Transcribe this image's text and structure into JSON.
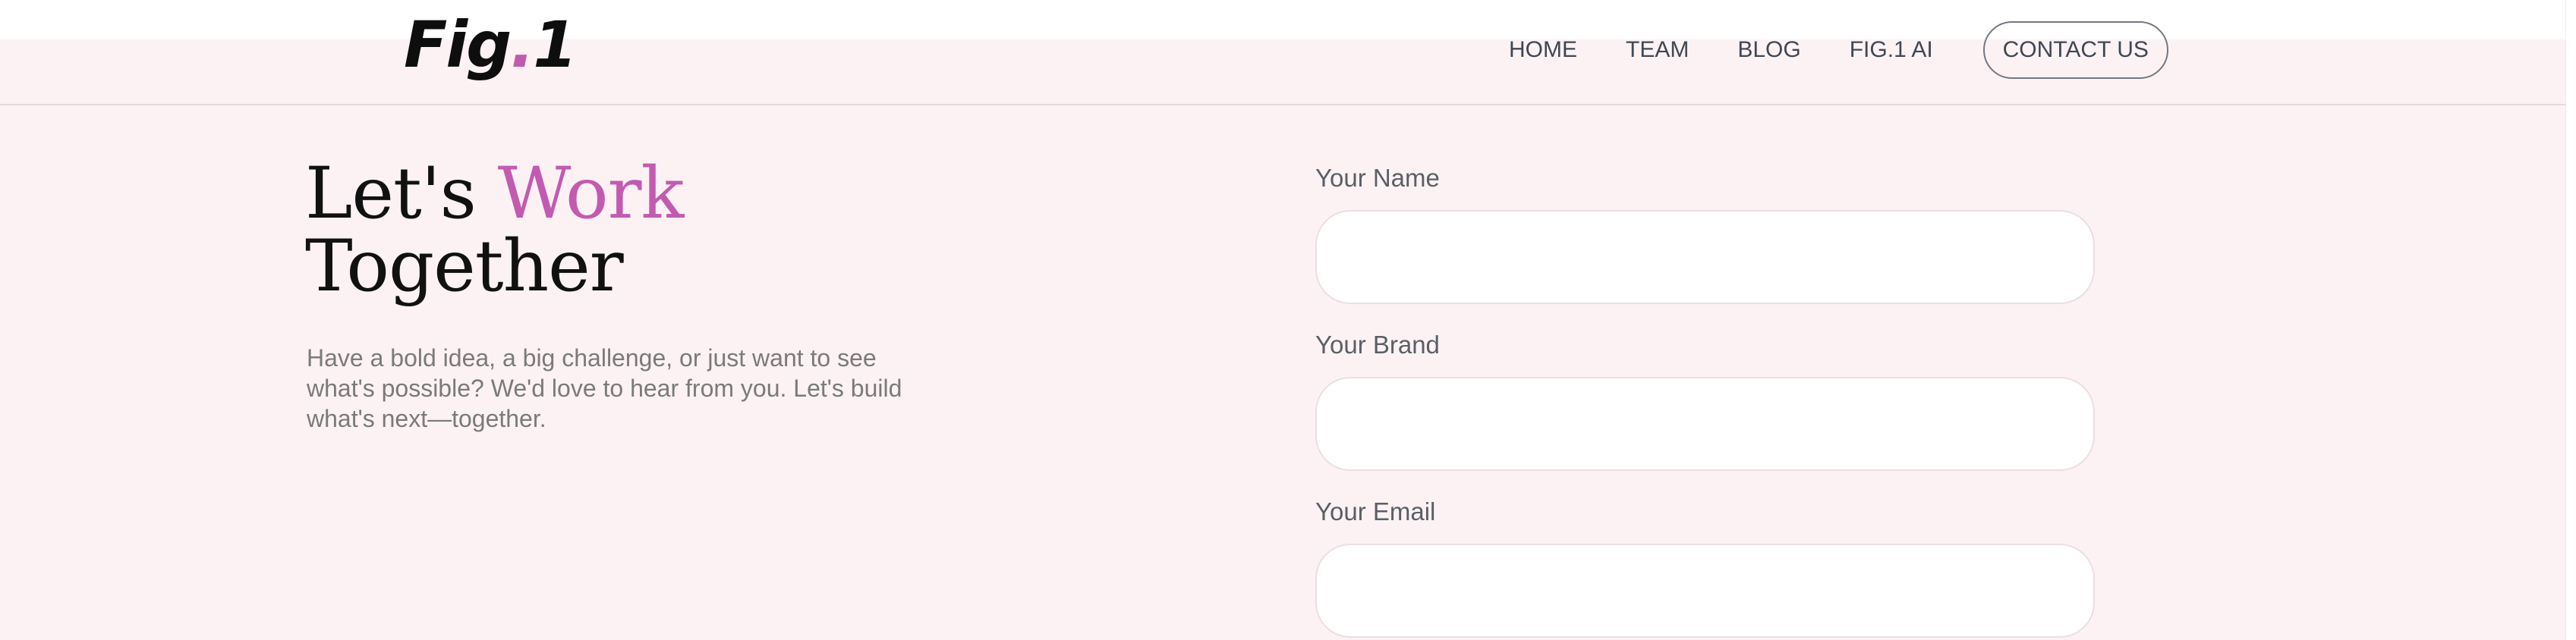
{
  "header": {
    "logo": {
      "part1": "Fig",
      "dot": ".",
      "part2": "1"
    },
    "nav": {
      "home": "HOME",
      "team": "TEAM",
      "blog": "BLOG",
      "fig1ai": "FIG.1 AI",
      "contact": "CONTACT US"
    }
  },
  "hero": {
    "title_word1": "Let's ",
    "title_accent": "Work",
    "title_line2": "Together",
    "description": "Have a bold idea, a big challenge, or just want to see what's possible? We'd love to hear from you. Let's build what's next—together."
  },
  "form": {
    "name": {
      "label": "Your Name",
      "value": ""
    },
    "brand": {
      "label": "Your Brand",
      "value": ""
    },
    "email": {
      "label": "Your Email",
      "value": ""
    }
  },
  "colors": {
    "accent": "#c35ab1",
    "background": "#fcf2f3",
    "text_dark": "#111111",
    "text_muted": "#7a7a7a"
  }
}
